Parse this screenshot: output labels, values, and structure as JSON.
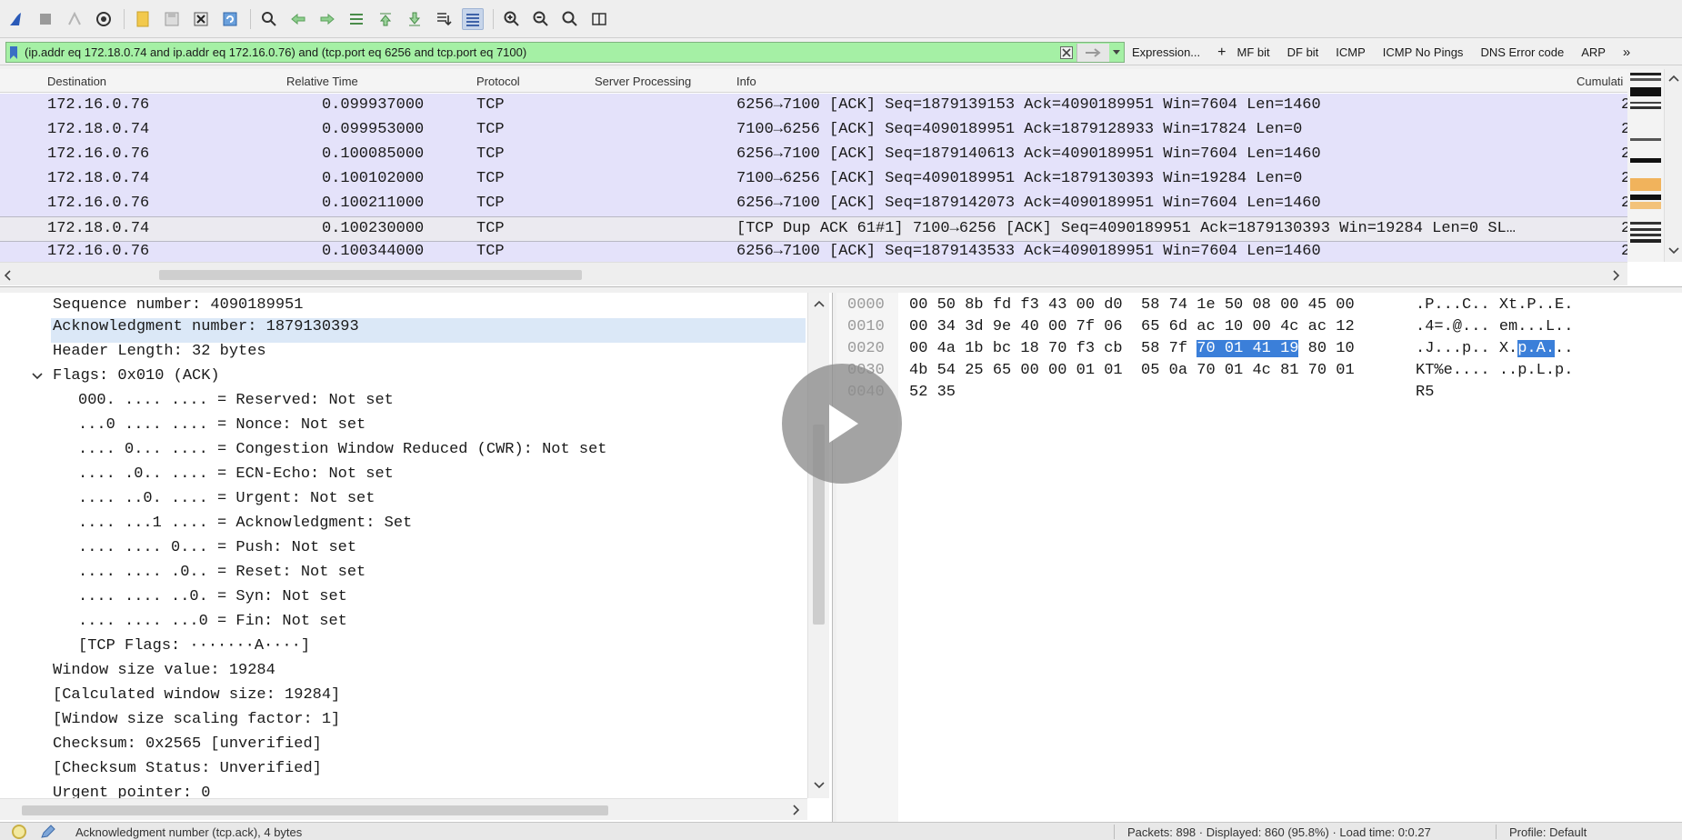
{
  "filter": {
    "value": "(ip.addr eq 172.18.0.74 and ip.addr eq 172.16.0.76) and (tcp.port eq 6256 and tcp.port eq 7100)",
    "expression_label": "Expression...",
    "plus_label": "+",
    "buttons": [
      "MF bit",
      "DF bit",
      "ICMP",
      "ICMP No Pings",
      "DNS Error code",
      "ARP"
    ],
    "more_label": "»"
  },
  "packet_list": {
    "columns": {
      "destination": "Destination",
      "relative_time": "Relative Time",
      "protocol": "Protocol",
      "server_processing": "Server Processing",
      "info": "Info",
      "cumulative": "Cumulati"
    },
    "rows": [
      {
        "dst": "172.16.0.76",
        "time": "0.099937000",
        "proto": "TCP",
        "info": "6256→7100 [ACK] Seq=1879139153 Ack=4090189951 Win=7604 Len=1460",
        "cum": "2"
      },
      {
        "dst": "172.18.0.74",
        "time": "0.099953000",
        "proto": "TCP",
        "info": "7100→6256 [ACK] Seq=4090189951 Ack=1879128933 Win=17824 Len=0",
        "cum": "2"
      },
      {
        "dst": "172.16.0.76",
        "time": "0.100085000",
        "proto": "TCP",
        "info": "6256→7100 [ACK] Seq=1879140613 Ack=4090189951 Win=7604 Len=1460",
        "cum": "2"
      },
      {
        "dst": "172.18.0.74",
        "time": "0.100102000",
        "proto": "TCP",
        "info": "7100→6256 [ACK] Seq=4090189951 Ack=1879130393 Win=19284 Len=0",
        "cum": "2"
      },
      {
        "dst": "172.16.0.76",
        "time": "0.100211000",
        "proto": "TCP",
        "info": "6256→7100 [ACK] Seq=1879142073 Ack=4090189951 Win=7604 Len=1460",
        "cum": "2"
      },
      {
        "dst": "172.18.0.74",
        "time": "0.100230000",
        "proto": "TCP",
        "info": "[TCP Dup ACK 61#1] 7100→6256 [ACK] Seq=4090189951 Ack=1879130393 Win=19284 Len=0 SL…",
        "cum": "2"
      },
      {
        "dst": "172.16.0.76",
        "time": "0.100344000",
        "proto": "TCP",
        "info": "6256→7100 [ACK] Seq=1879143533 Ack=4090189951 Win=7604 Len=1460",
        "cum": "2"
      }
    ]
  },
  "details": {
    "lines": [
      "Sequence number: 4090189951",
      "Acknowledgment number: 1879130393",
      "Header Length: 32 bytes",
      "Flags: 0x010 (ACK)",
      "000. .... .... = Reserved: Not set",
      "...0 .... .... = Nonce: Not set",
      ".... 0... .... = Congestion Window Reduced (CWR): Not set",
      ".... .0.. .... = ECN-Echo: Not set",
      ".... ..0. .... = Urgent: Not set",
      ".... ...1 .... = Acknowledgment: Set",
      ".... .... 0... = Push: Not set",
      ".... .... .0.. = Reset: Not set",
      ".... .... ..0. = Syn: Not set",
      ".... .... ...0 = Fin: Not set",
      "[TCP Flags: ·······A····]",
      "Window size value: 19284",
      "[Calculated window size: 19284]",
      "[Window size scaling factor: 1]",
      "Checksum: 0x2565 [unverified]",
      "[Checksum Status: Unverified]",
      "Urgent pointer: 0"
    ]
  },
  "bytes": {
    "rows": [
      {
        "offset": "0000",
        "hex": "00 50 8b fd f3 43 00 d0  58 74 1e 50 08 00 45 00",
        "ascii": ".P...C.. Xt.P..E."
      },
      {
        "offset": "0010",
        "hex": "00 34 3d 9e 40 00 7f 06  65 6d ac 10 00 4c ac 12",
        "ascii": ".4=.@... em...L.."
      },
      {
        "offset": "0020",
        "hex_pre": "00 4a 1b bc 18 70 f3 cb  58 7f ",
        "hex_hl": "70 01 41 19",
        "hex_post": " 80 10",
        "ascii_pre": ".J...p.. X.",
        "ascii_hl": "p.A.",
        "ascii_post": ".."
      },
      {
        "offset": "0030",
        "hex": "4b 54 25 65 00 00 01 01  05 0a 70 01 4c 81 70 01",
        "ascii": "KT%e.... ..p.L.p."
      },
      {
        "offset": "0040",
        "hex": "52 35",
        "ascii": "R5"
      }
    ]
  },
  "status": {
    "field_info": "Acknowledgment number (tcp.ack), 4 bytes",
    "packets": "Packets: 898 · Displayed: 860 (95.8%) · Load time: 0:0.27",
    "profile": "Profile: Default"
  },
  "colors": {
    "filter_valid": "#a5f0a5",
    "row_tcp": "#e4e2fa",
    "byte_highlight": "#3b7fd9"
  }
}
